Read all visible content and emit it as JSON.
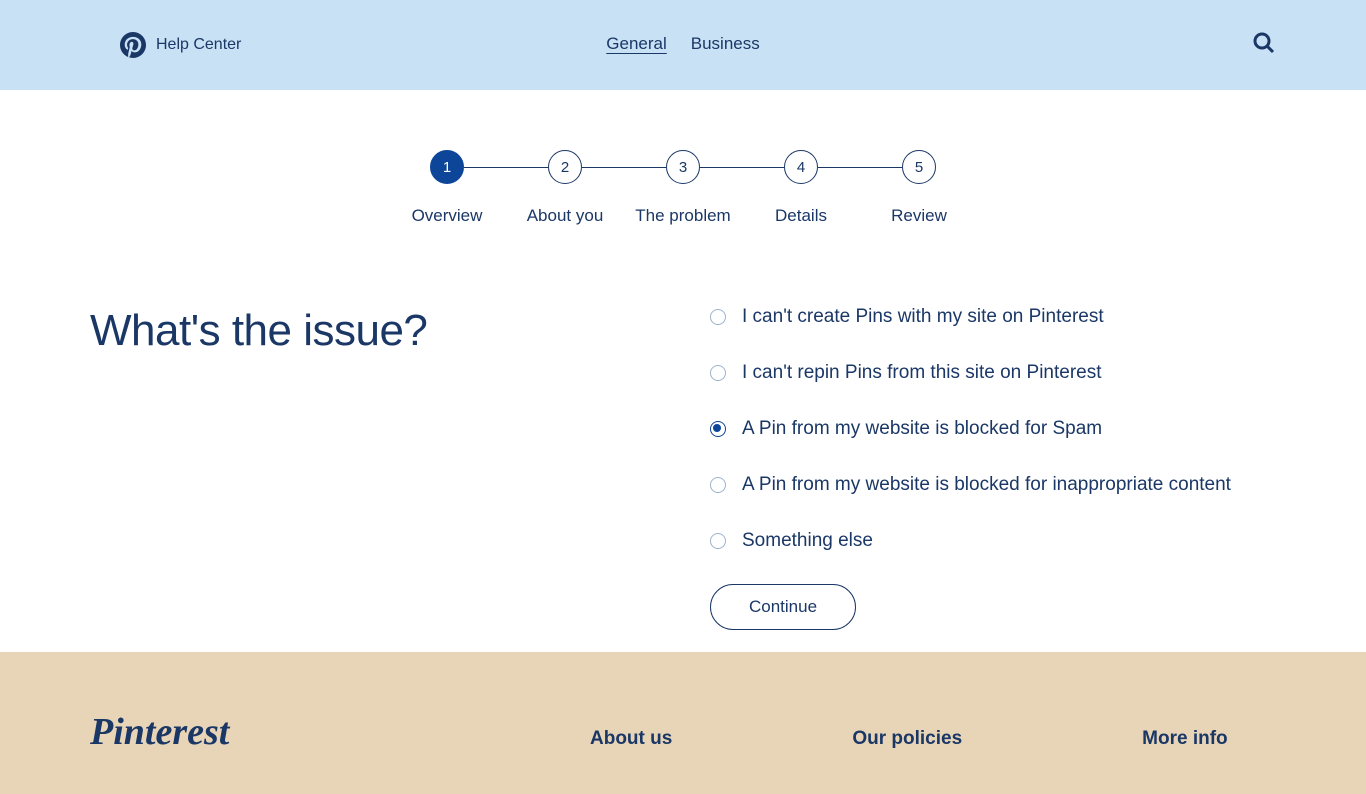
{
  "header": {
    "help_center": "Help Center",
    "tabs": {
      "general": "General",
      "business": "Business"
    }
  },
  "stepper": {
    "steps": [
      {
        "number": "1",
        "label": "Overview"
      },
      {
        "number": "2",
        "label": "About you"
      },
      {
        "number": "3",
        "label": "The problem"
      },
      {
        "number": "4",
        "label": "Details"
      },
      {
        "number": "5",
        "label": "Review"
      }
    ]
  },
  "question": {
    "title": "What's the issue?",
    "options": [
      "I can't create Pins with my site on Pinterest",
      "I can't repin Pins from this site on Pinterest",
      "A Pin from my website is blocked for Spam",
      "A Pin from my website is blocked for inappropriate content",
      "Something else"
    ],
    "selected_index": 2,
    "continue_label": "Continue"
  },
  "footer": {
    "logo": "Pinterest",
    "columns": [
      "About us",
      "Our policies",
      "More info"
    ]
  }
}
